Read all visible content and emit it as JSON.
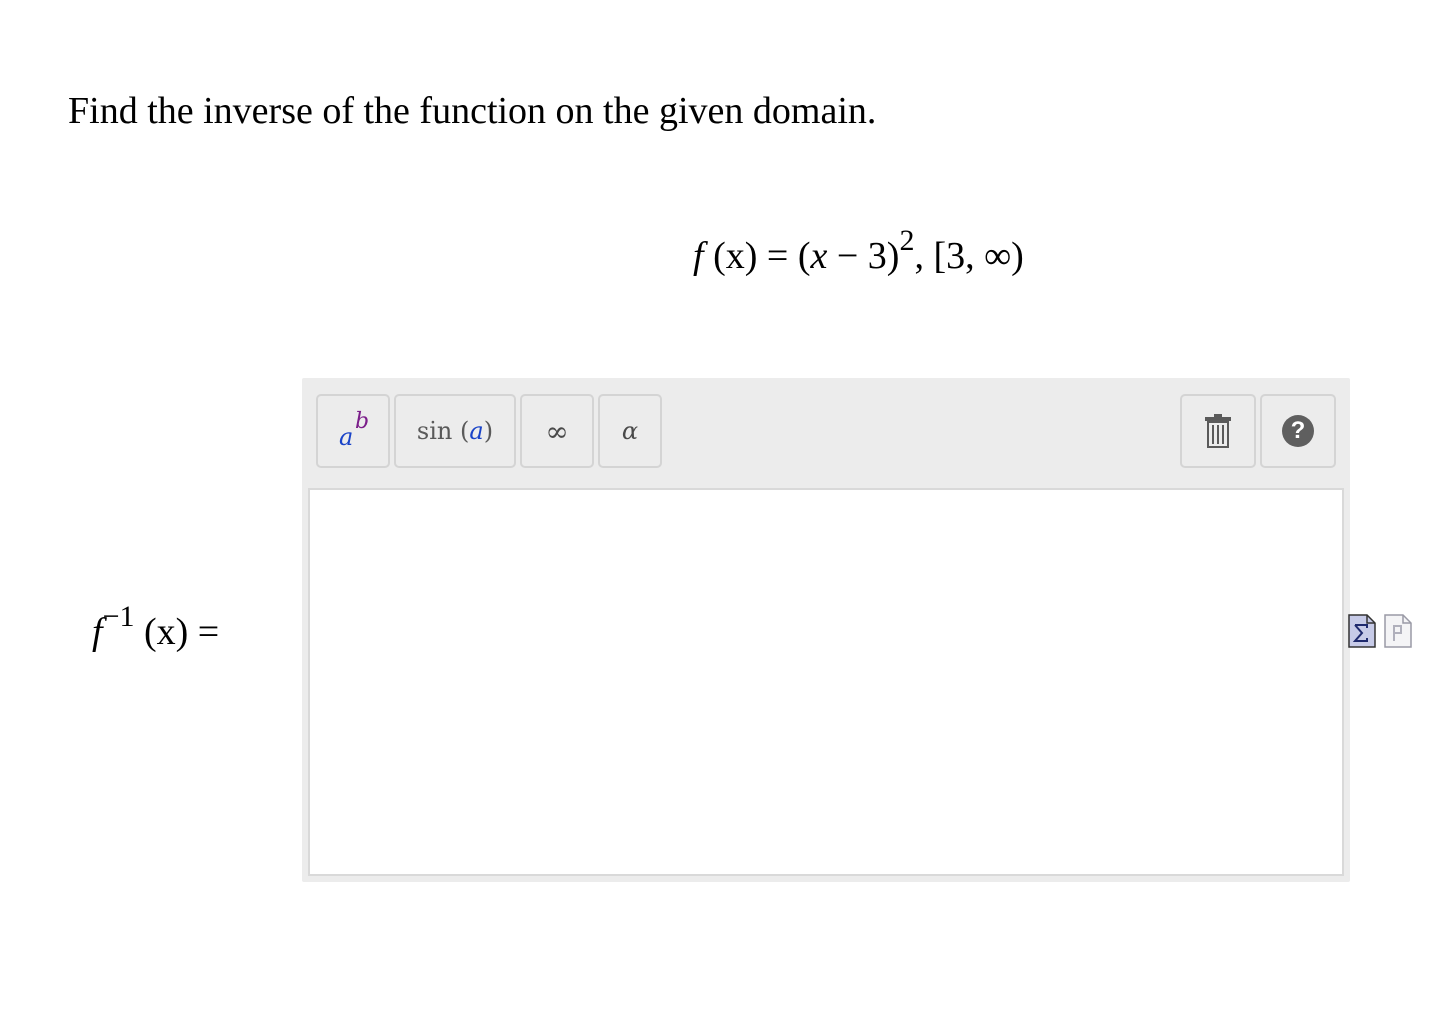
{
  "question": {
    "prompt": "Find the inverse of the function on the given domain."
  },
  "function_display": {
    "f": "f",
    "lhs_var": "(x)",
    "equals": " = ",
    "paren_open": "(",
    "var": "x",
    "minus_three": " − 3)",
    "exponent": "2",
    "domain": ", [3, ∞)"
  },
  "answer": {
    "f": "f",
    "exponent": "−1",
    "var": "(x)",
    "equals": " ="
  },
  "toolbar": {
    "power_base": "a",
    "power_exp": "b",
    "sin_label": "sin (",
    "sin_arg": "a",
    "sin_close": ")",
    "infinity_label": "∞",
    "alpha_label": "α",
    "help_label": "?"
  },
  "input": {
    "value": ""
  },
  "icons": {
    "power": "superscript-icon",
    "sin": "trig-function-icon",
    "infinity": "infinity-icon",
    "alpha": "greek-letter-icon",
    "trash": "trash-icon",
    "help": "help-icon",
    "math_entry": "math-entry-icon",
    "plain_entry": "plain-entry-icon"
  },
  "colors": {
    "toolbar_bg": "#ececec",
    "power_base": "#1a44c8",
    "power_exp": "#7b1e8a",
    "help_bg": "#5f5f5f"
  }
}
